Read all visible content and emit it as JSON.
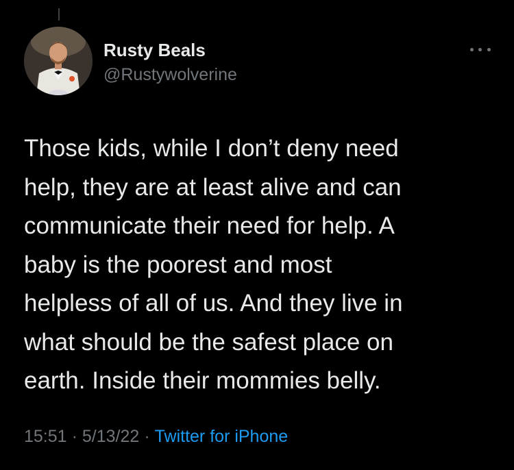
{
  "user": {
    "display_name": "Rusty Beals",
    "handle": "@Rustywolverine"
  },
  "tweet": {
    "text": "Those kids, while I don’t deny need\nhelp, they are at least alive and can\ncommunicate their need for help. A\nbaby is the poorest and most\nhelpless of all of us. And they live in\nwhat should be the safest place on\nearth. Inside their mommies belly."
  },
  "meta": {
    "time": "15:51",
    "separator": "·",
    "date": "5/13/22",
    "source": "Twitter for iPhone"
  },
  "icons": {
    "more": "more-horizontal-icon",
    "avatar": "profile-photo"
  },
  "colors": {
    "background": "#000000",
    "text": "#e7e9ea",
    "secondary_text": "#71767b",
    "link": "#1d9bf0"
  }
}
